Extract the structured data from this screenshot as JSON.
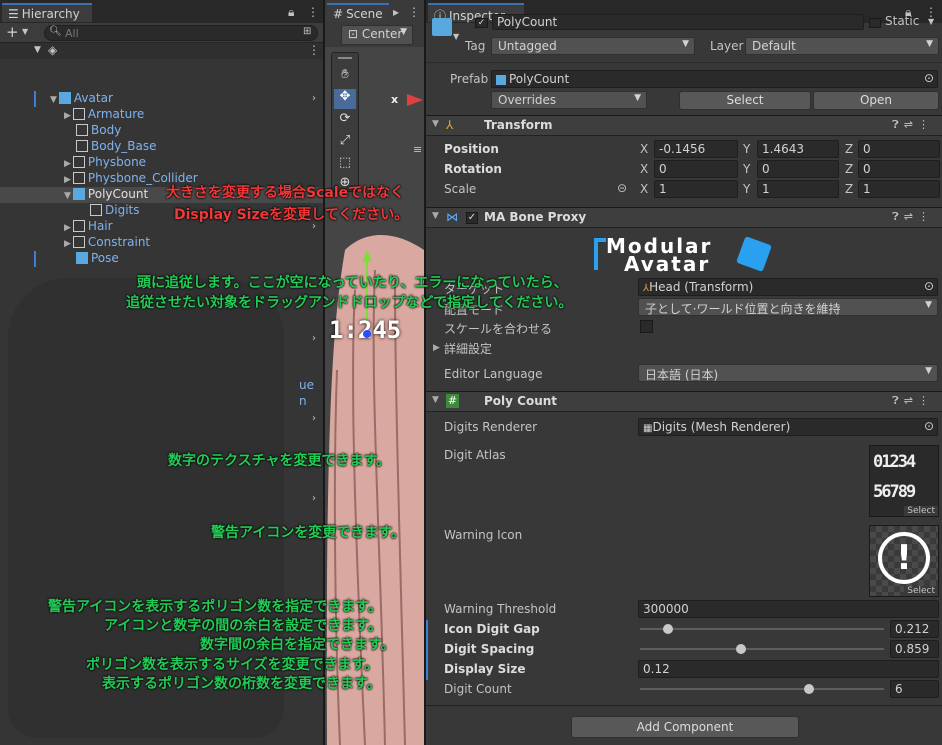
{
  "hierarchy": {
    "tab": "Hierarchy",
    "search_placeholder": "All",
    "items": [
      {
        "label": "Avatar"
      },
      {
        "label": "Armature"
      },
      {
        "label": "Body"
      },
      {
        "label": "Body_Base"
      },
      {
        "label": "Physbone"
      },
      {
        "label": "Physbone_Collider"
      },
      {
        "label": "PolyCount"
      },
      {
        "label": "Digits"
      },
      {
        "label": "Hair"
      },
      {
        "label": "Constraint"
      },
      {
        "label": "Pose"
      }
    ],
    "partial_labels": [
      "ue",
      "n"
    ]
  },
  "scene": {
    "tab": "Scene",
    "pivot": "Center",
    "preview_digits": "1:245",
    "x_axis": "x"
  },
  "inspector": {
    "tab": "Inspector",
    "object_name": "PolyCount",
    "static_label": "Static",
    "tag_label": "Tag",
    "tag_value": "Untagged",
    "layer_label": "Layer",
    "layer_value": "Default",
    "prefab_label": "Prefab",
    "prefab_value": "PolyCount",
    "overrides_label": "Overrides",
    "select_label": "Select",
    "open_label": "Open",
    "transform": {
      "title": "Transform",
      "rows": [
        {
          "label": "Position",
          "x": "-0.1456",
          "y": "1.4643",
          "z": "0"
        },
        {
          "label": "Rotation",
          "x": "0",
          "y": "0",
          "z": "0"
        },
        {
          "label": "Scale",
          "x": "1",
          "y": "1",
          "z": "1"
        }
      ],
      "axes": [
        "X",
        "Y",
        "Z"
      ]
    },
    "bone_proxy": {
      "title": "MA Bone Proxy",
      "logo_line1": "Modular",
      "logo_line2": "Avatar",
      "target_label": "ターゲット",
      "target_value": "Head (Transform)",
      "placement_label": "配置モード",
      "placement_value": "子として·ワールド位置と向きを維持",
      "scale_label": "スケールを合わせる",
      "advanced_label": "詳細設定",
      "language_label": "Editor Language",
      "language_value": "日本語 (日本)"
    },
    "poly_count": {
      "title": "Poly Count",
      "digits_renderer_label": "Digits Renderer",
      "digits_renderer_value": "Digits (Mesh Renderer)",
      "digit_atlas_label": "Digit Atlas",
      "atlas_row1": "01234",
      "atlas_row2": "56789",
      "thumb_select": "Select",
      "warning_icon_label": "Warning Icon",
      "warning_glyph": "!",
      "warning_threshold_label": "Warning Threshold",
      "warning_threshold_value": "300000",
      "icon_digit_gap_label": "Icon Digit Gap",
      "icon_digit_gap_value": "0.212",
      "icon_digit_gap_fraction": 0.1,
      "digit_spacing_label": "Digit Spacing",
      "digit_spacing_value": "0.859",
      "digit_spacing_fraction": 0.41,
      "display_size_label": "Display Size",
      "display_size_value": "0.12",
      "digit_count_label": "Digit Count",
      "digit_count_value": "6",
      "digit_count_fraction": 0.7
    },
    "add_component": "Add Component"
  },
  "annotations": {
    "scale_note_1": "大きさを変更する場合Scaleではなく",
    "scale_note_2": "Display Sizeを変更してください。",
    "head_note_1": "頭に追従します。ここが空になっていたり、エラーになっていたら、",
    "head_note_2": "追従させたい対象をドラッグアンドドロップなどで指定してください。",
    "atlas_note": "数字のテクスチャを変更できます。",
    "warn_icon_note": "警告アイコンを変更できます。",
    "threshold_note": "警告アイコンを表示するポリゴン数を指定できます。",
    "gap_note": "アイコンと数字の間の余白を設定できます。",
    "spacing_note": "数字間の余白を指定できます。",
    "size_note": "ポリゴン数を表示するサイズを変更できます。",
    "count_note": "表示するポリゴン数の桁数を変更できます。"
  }
}
